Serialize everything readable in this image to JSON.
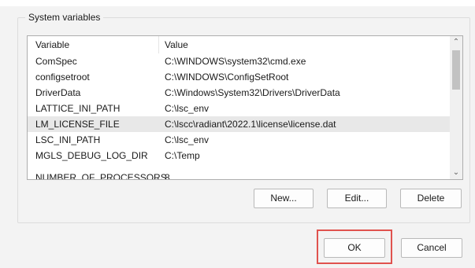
{
  "groupbox": {
    "title": "System variables"
  },
  "list": {
    "columns": {
      "variable": "Variable",
      "value": "Value"
    },
    "rows": [
      {
        "variable": "ComSpec",
        "value": "C:\\WINDOWS\\system32\\cmd.exe"
      },
      {
        "variable": "configsetroot",
        "value": "C:\\WINDOWS\\ConfigSetRoot"
      },
      {
        "variable": "DriverData",
        "value": "C:\\Windows\\System32\\Drivers\\DriverData"
      },
      {
        "variable": "LATTICE_INI_PATH",
        "value": "C:\\lsc_env"
      },
      {
        "variable": "LM_LICENSE_FILE",
        "value": "C:\\lscc\\radiant\\2022.1\\license\\license.dat"
      },
      {
        "variable": "LSC_INI_PATH",
        "value": "C:\\lsc_env"
      },
      {
        "variable": "MGLS_DEBUG_LOG_DIR",
        "value": "C:\\Temp"
      },
      {
        "variable": "NUMBER_OF_PROCESSORS",
        "value": "8"
      }
    ],
    "selected_index": 4
  },
  "buttons": {
    "new": "New...",
    "edit": "Edit...",
    "delete": "Delete",
    "ok": "OK",
    "cancel": "Cancel"
  },
  "colors": {
    "highlight": "#e0524e",
    "selected_row": "#e8e8e8"
  }
}
